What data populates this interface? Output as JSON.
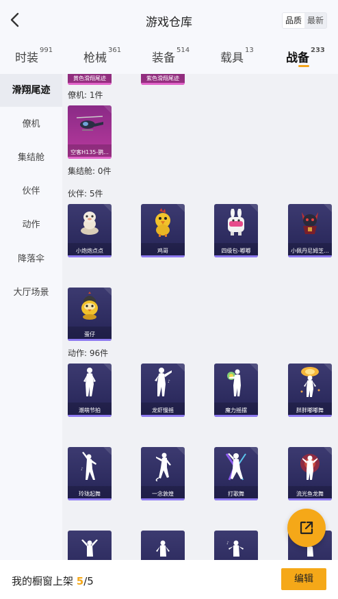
{
  "header": {
    "title": "游戏仓库",
    "sort_options": [
      "品质",
      "最新"
    ],
    "active_sort": "品质"
  },
  "tabs": [
    {
      "label": "时装",
      "count": "991"
    },
    {
      "label": "枪械",
      "count": "361"
    },
    {
      "label": "装备",
      "count": "514"
    },
    {
      "label": "载具",
      "count": "13"
    },
    {
      "label": "战备",
      "count": "233"
    }
  ],
  "active_tab": "战备",
  "sidebar": {
    "items": [
      "滑翔尾迹",
      "僚机",
      "集结舱",
      "伙伴",
      "动作",
      "降落伞",
      "大厅场景"
    ],
    "active": "滑翔尾迹"
  },
  "sections": {
    "trail_partial": [
      "黄色滑翔尾迹",
      "紫色滑翔尾迹"
    ],
    "wingman": {
      "title": "僚机: 1件",
      "items": [
        "空客H135-鹊..."
      ]
    },
    "capsule": {
      "title": "集结舱: 0件"
    },
    "companion": {
      "title": "伙伴: 5件",
      "items": [
        "小炮炮点点",
        "鸡哥",
        "四级包-嘟嘟",
        "小佩丹尼姆芝...",
        "蛋仔"
      ]
    },
    "emote": {
      "title": "动作: 96件",
      "items": [
        "潮萌节拍",
        "龙虾慢摇",
        "魔力摇摆",
        "胖胖嘟嘟舞",
        "玲珑起舞",
        "一念敦煌",
        "打歌舞",
        "流光鱼龙舞"
      ]
    }
  },
  "footer": {
    "label": "我的橱窗上架",
    "current": "5",
    "total": "/5",
    "edit_label": "编辑"
  },
  "colors": {
    "accent": "#f5a818",
    "card_bg": "#2c2b5e",
    "card_pink": "#b93a9e"
  }
}
